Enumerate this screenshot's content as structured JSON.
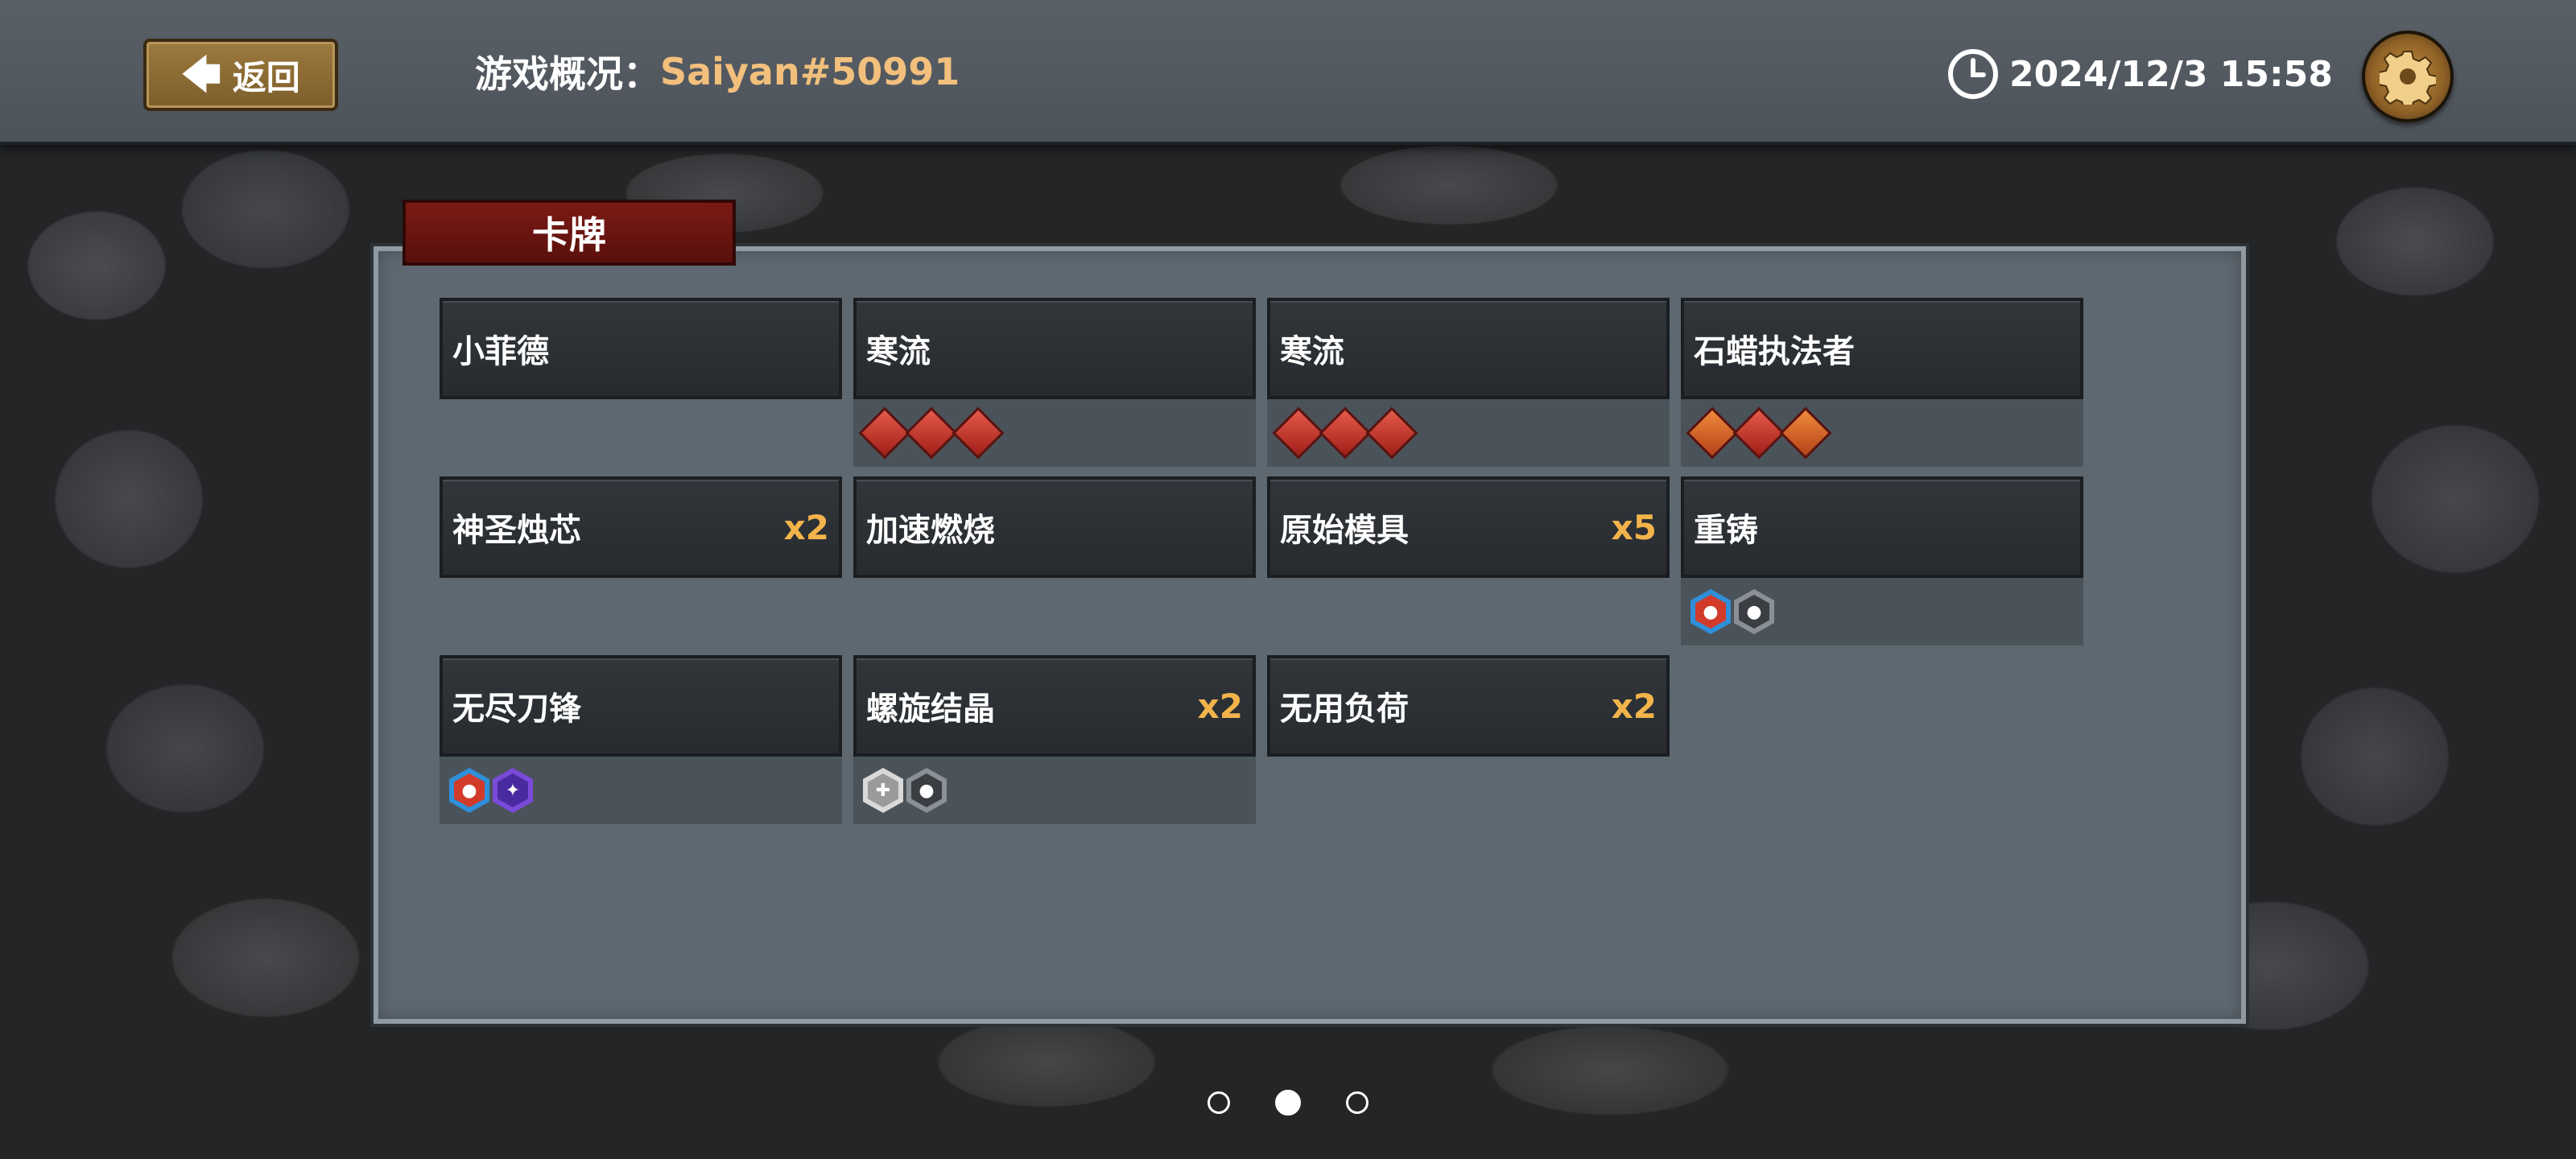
{
  "header": {
    "back_label": "返回",
    "title_label": "游戏概况：",
    "player_name": "Saiyan#50991",
    "datetime": "2024/12/3 15:58",
    "clock_icon": "clock-icon",
    "settings_icon": "gear-icon"
  },
  "panel": {
    "tab_label": "卡牌",
    "cards": [
      {
        "name": "小菲德",
        "count": "",
        "tags": []
      },
      {
        "name": "寒流",
        "count": "",
        "tags": [
          "red-diamond",
          "red-diamond",
          "red-diamond"
        ]
      },
      {
        "name": "寒流",
        "count": "",
        "tags": [
          "red-diamond",
          "red-diamond",
          "red-diamond"
        ]
      },
      {
        "name": "石蜡执法者",
        "count": "",
        "tags": [
          "orange-diamond",
          "red-diamond",
          "orange-diamond"
        ]
      },
      {
        "name": "神圣烛芯",
        "count": "x2",
        "tags": []
      },
      {
        "name": "加速燃烧",
        "count": "",
        "tags": []
      },
      {
        "name": "原始模具",
        "count": "x5",
        "tags": []
      },
      {
        "name": "重铸",
        "count": "",
        "tags": [
          "blue-hex",
          "dark-hex"
        ]
      },
      {
        "name": "无尽刀锋",
        "count": "",
        "tags": [
          "blue-hex",
          "purple-hex"
        ]
      },
      {
        "name": "螺旋结晶",
        "count": "x2",
        "tags": [
          "white-hex",
          "dark-hex"
        ]
      },
      {
        "name": "无用负荷",
        "count": "x2",
        "tags": []
      }
    ]
  },
  "pagination": {
    "pages": 3,
    "current": 2
  },
  "colors": {
    "accent_name": "#f2c07c",
    "count": "#f2b44a",
    "tab_red": "#7a1a14"
  }
}
